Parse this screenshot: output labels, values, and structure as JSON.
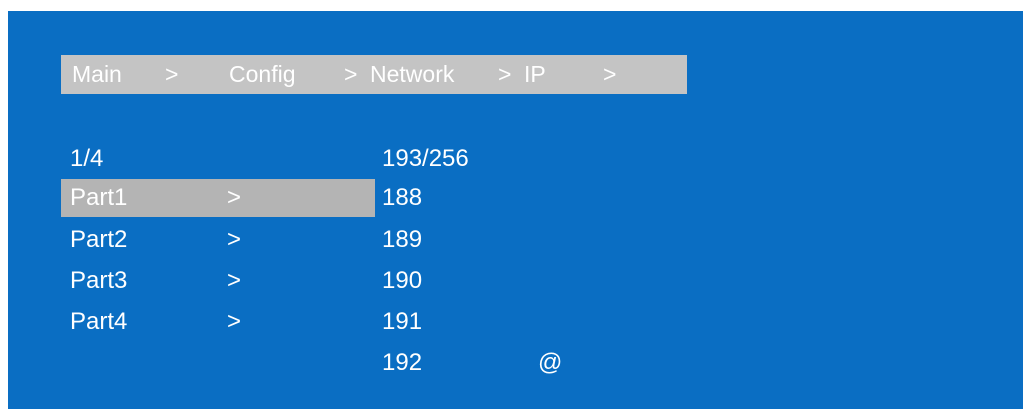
{
  "breadcrumb": {
    "items": [
      {
        "label": "Main",
        "sep": ">"
      },
      {
        "label": "Config",
        "sep": ">"
      },
      {
        "label": "Network",
        "sep": ">"
      },
      {
        "label": "IP",
        "sep": ">"
      }
    ]
  },
  "left_menu": {
    "page": "1/4",
    "items": [
      {
        "label": "Part1",
        "arrow": ">",
        "selected": true
      },
      {
        "label": "Part2",
        "arrow": ">",
        "selected": false
      },
      {
        "label": "Part3",
        "arrow": ">",
        "selected": false
      },
      {
        "label": "Part4",
        "arrow": ">",
        "selected": false
      }
    ]
  },
  "right_list": {
    "position": "193/256",
    "values": [
      "188",
      "189",
      "190",
      "191",
      "192"
    ],
    "marker": "@"
  },
  "colors": {
    "background": "#0a6ec3",
    "breadcrumb_bg": "#c4c4c4",
    "selection_bg": "#b4b4b4",
    "text": "#ffffff"
  }
}
